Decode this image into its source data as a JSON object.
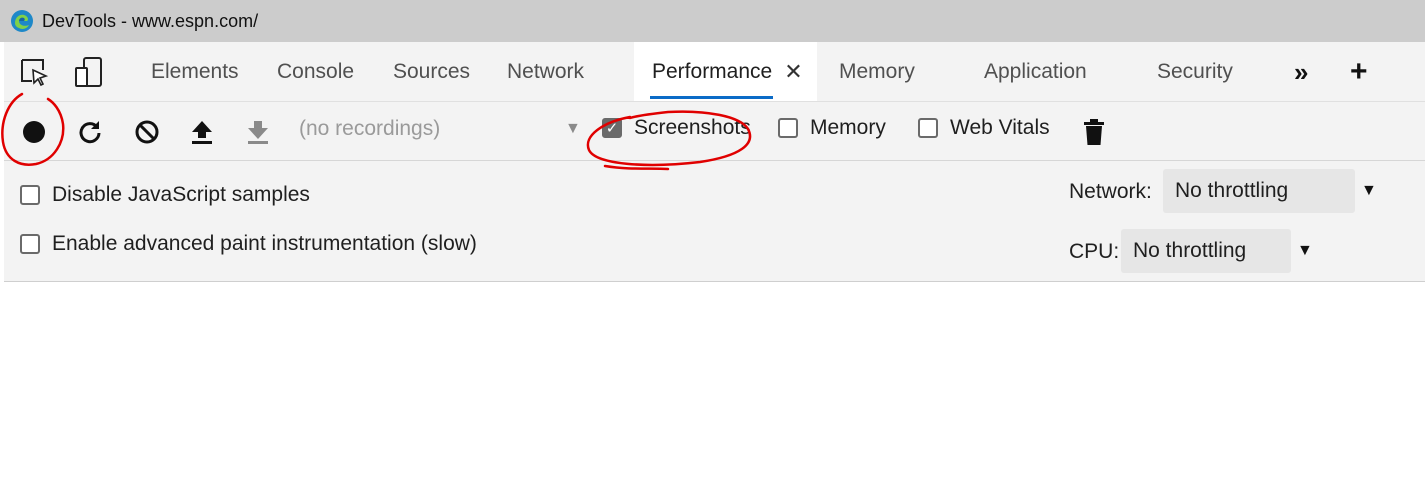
{
  "window": {
    "title": "DevTools - www.espn.com/",
    "logo_icon": "edge-logo-icon"
  },
  "tabbar": {
    "tools": [
      {
        "name": "inspect-element-icon"
      },
      {
        "name": "device-emulation-icon"
      }
    ],
    "tabs": [
      {
        "label": "Elements"
      },
      {
        "label": "Console"
      },
      {
        "label": "Sources"
      },
      {
        "label": "Network"
      },
      {
        "label": "Performance",
        "active": true
      },
      {
        "label": "Memory"
      },
      {
        "label": "Application"
      },
      {
        "label": "Security"
      }
    ],
    "close_glyph": "✕",
    "more_glyph": "»",
    "add_glyph": "+",
    "active_color": "#0b6bc7"
  },
  "toolbar": {
    "icons": [
      "record-icon",
      "reload-record-icon",
      "clear-icon",
      "upload-icon",
      "download-icon",
      "trash-icon"
    ],
    "recordings_placeholder": "(no recordings)",
    "dropdown_glyph": "▼",
    "checkboxes": [
      {
        "label": "Screenshots",
        "checked": true
      },
      {
        "label": "Memory",
        "checked": false
      },
      {
        "label": "Web Vitals",
        "checked": false
      }
    ]
  },
  "settings": {
    "options": [
      {
        "label": "Disable JavaScript samples",
        "checked": false
      },
      {
        "label": "Enable advanced paint instrumentation (slow)",
        "checked": false
      }
    ],
    "network": {
      "label": "Network:",
      "value": "No throttling"
    },
    "cpu": {
      "label": "CPU:",
      "value": "No throttling"
    },
    "dropdown_glyph": "▼"
  },
  "annotation_color": "#e00000"
}
